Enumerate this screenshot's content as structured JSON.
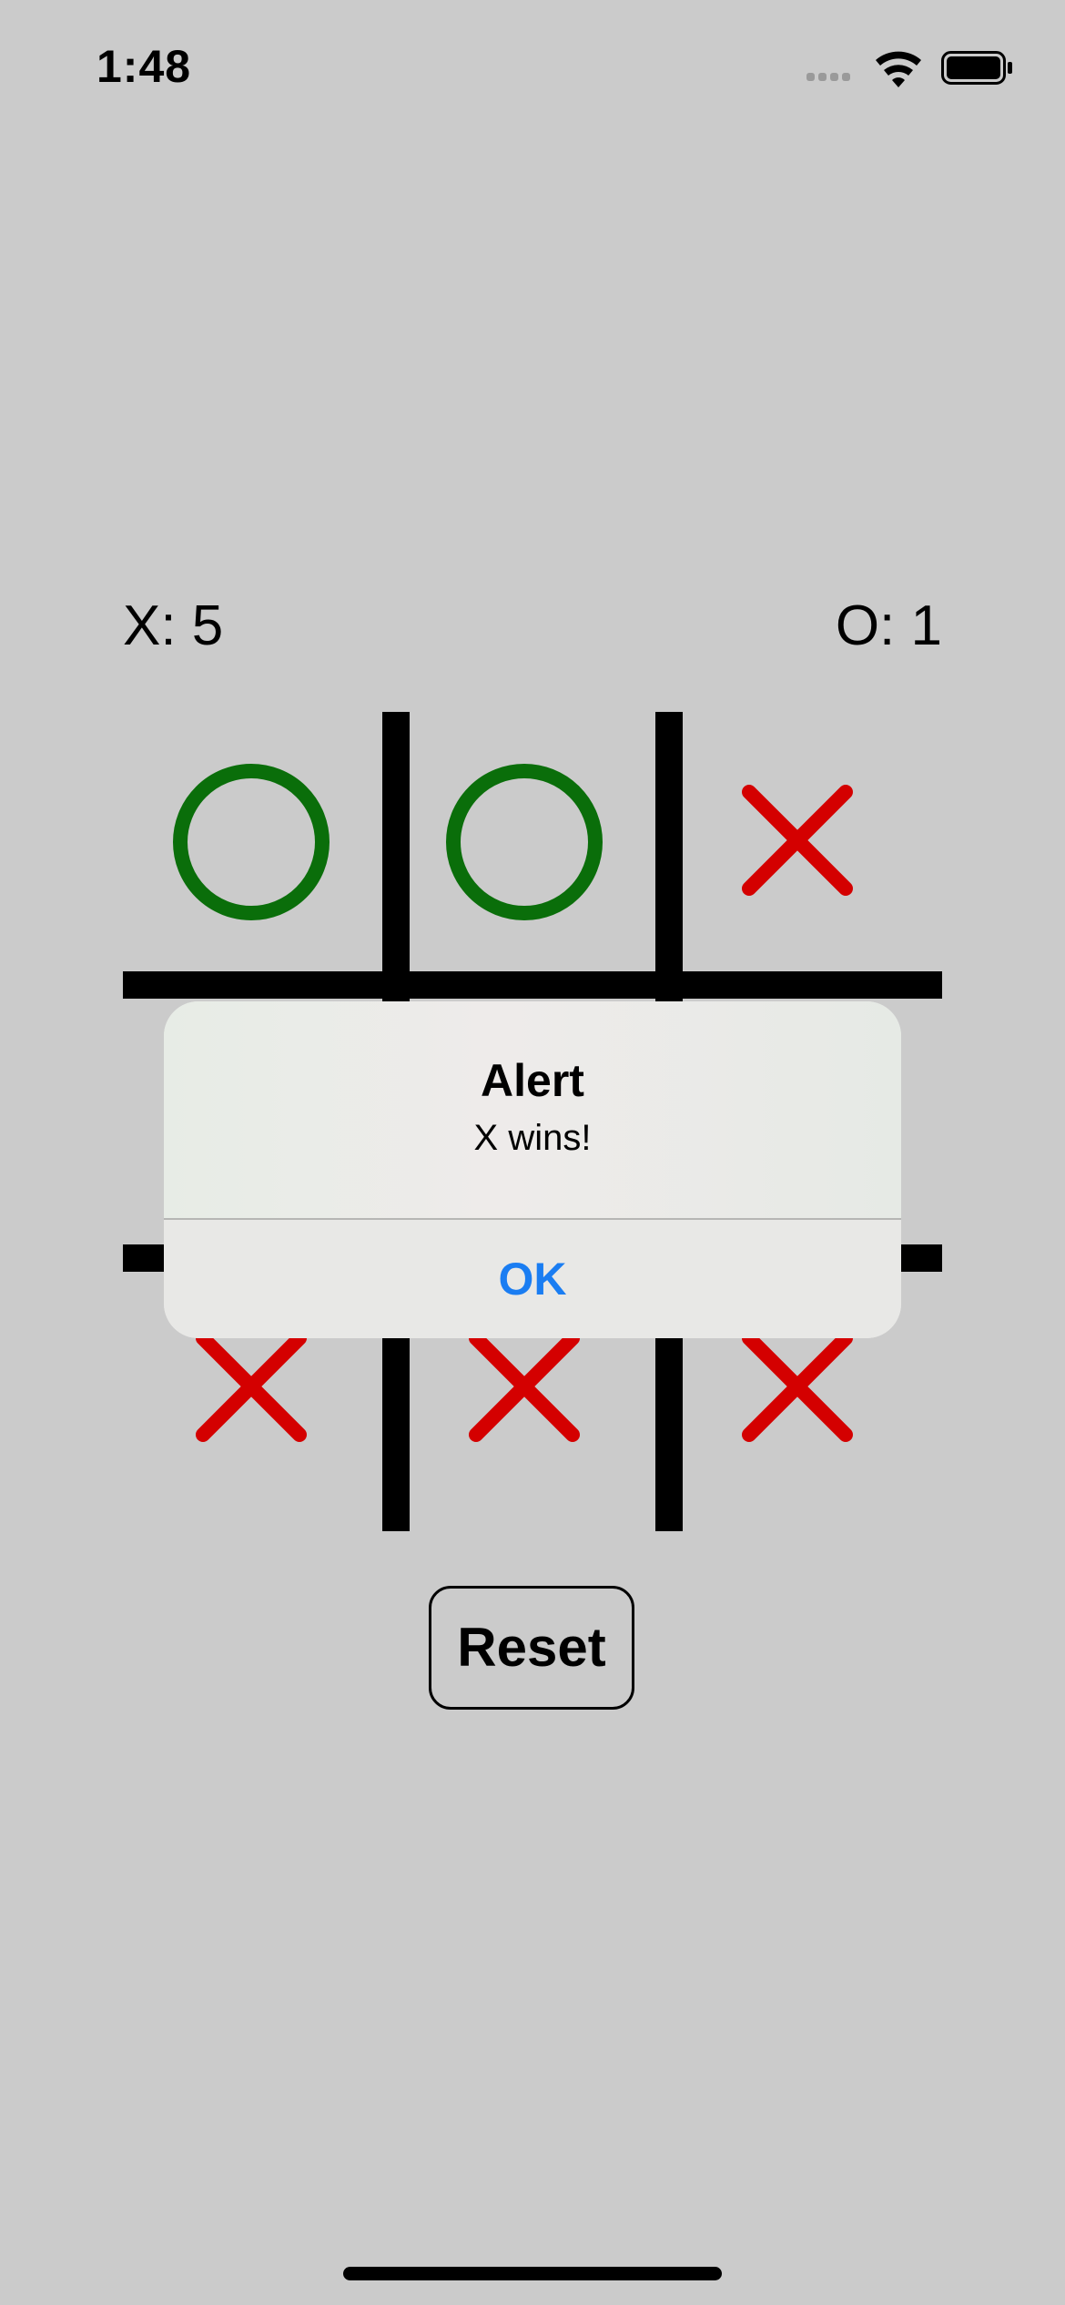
{
  "status_bar": {
    "time": "1:48",
    "icons": [
      "cellular-signal-icon",
      "wifi-icon",
      "battery-icon"
    ]
  },
  "scores": {
    "x_label": "X: 5",
    "o_label": "O: 1"
  },
  "board": {
    "cells": [
      "O",
      "O",
      "X",
      "",
      "",
      "",
      "X",
      "X",
      "X"
    ],
    "colors": {
      "x": "#d40000",
      "o": "#0a6e0a",
      "grid": "#000000"
    }
  },
  "alert": {
    "title": "Alert",
    "message": "X wins!",
    "ok_label": "OK",
    "ok_color": "#1a7df2"
  },
  "controls": {
    "reset_label": "Reset"
  },
  "colors": {
    "background": "#cbcbcb"
  }
}
